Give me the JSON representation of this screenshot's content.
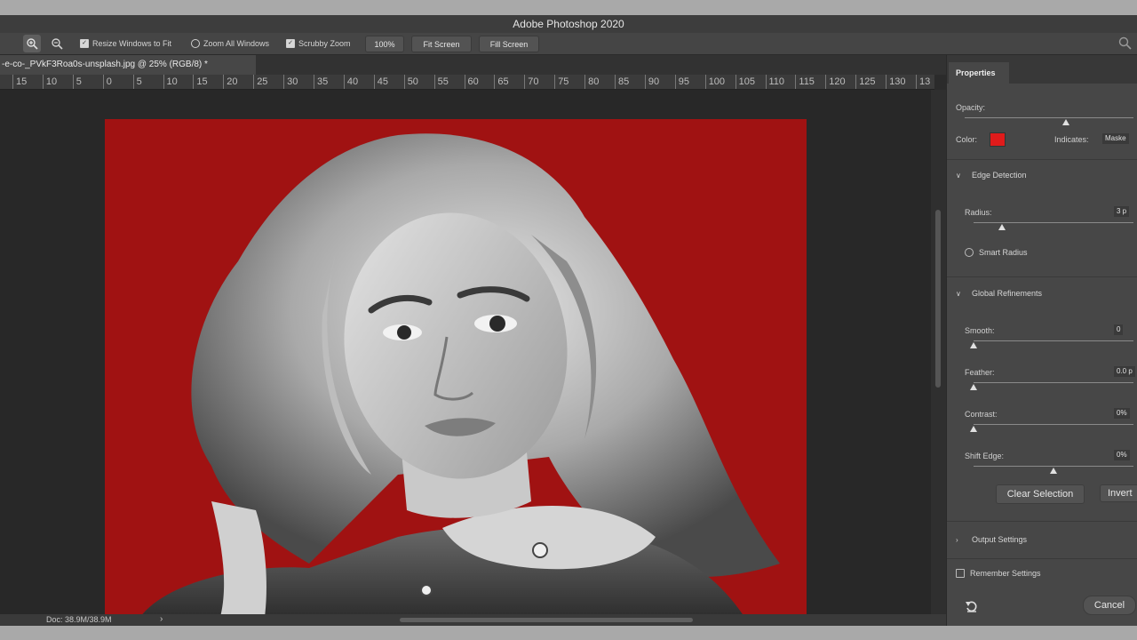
{
  "window": {
    "title": "Adobe Photoshop 2020"
  },
  "options_bar": {
    "resize_windows_label": "Resize Windows to Fit",
    "zoom_all_label": "Zoom All Windows",
    "scrubby_zoom_label": "Scrubby Zoom",
    "zoom_value": "100%",
    "fit_screen": "Fit Screen",
    "fill_screen": "Fill Screen"
  },
  "document": {
    "tab_label": "-e-co-_PVkF3Roa0s-unsplash.jpg @ 25% (RGB/8) *",
    "zoom_percent": 25,
    "status": "Doc: 38.9M/38.9M"
  },
  "ruler": {
    "labels": [
      "15",
      "10",
      "5",
      "0",
      "5",
      "10",
      "15",
      "20",
      "25",
      "30",
      "35",
      "40",
      "45",
      "50",
      "55",
      "60",
      "65",
      "70",
      "75",
      "80",
      "85",
      "90",
      "95",
      "100",
      "105",
      "110",
      "115",
      "120",
      "125",
      "130",
      "13"
    ]
  },
  "canvas": {
    "background_color": "#a01212"
  },
  "properties": {
    "tab": "Properties",
    "opacity_label": "Opacity:",
    "opacity_fraction": 0.6,
    "color_label": "Color:",
    "color_value": "#e01b1b",
    "indicates_label": "Indicates:",
    "indicates_value": "Maske",
    "edge_detection": {
      "title": "Edge Detection",
      "radius_label": "Radius:",
      "radius_value": "3 p",
      "radius_fraction": 0.18,
      "smart_radius_label": "Smart Radius"
    },
    "global_refinements": {
      "title": "Global Refinements",
      "smooth_label": "Smooth:",
      "smooth_value": "0",
      "smooth_fraction": 0.0,
      "feather_label": "Feather:",
      "feather_value": "0.0 p",
      "feather_fraction": 0.0,
      "contrast_label": "Contrast:",
      "contrast_value": "0%",
      "contrast_fraction": 0.0,
      "shift_edge_label": "Shift Edge:",
      "shift_edge_value": "0%",
      "shift_edge_fraction": 0.5
    },
    "clear_selection": "Clear Selection",
    "invert": "Invert",
    "output_settings": "Output Settings",
    "remember_settings": "Remember Settings",
    "cancel": "Cancel"
  }
}
